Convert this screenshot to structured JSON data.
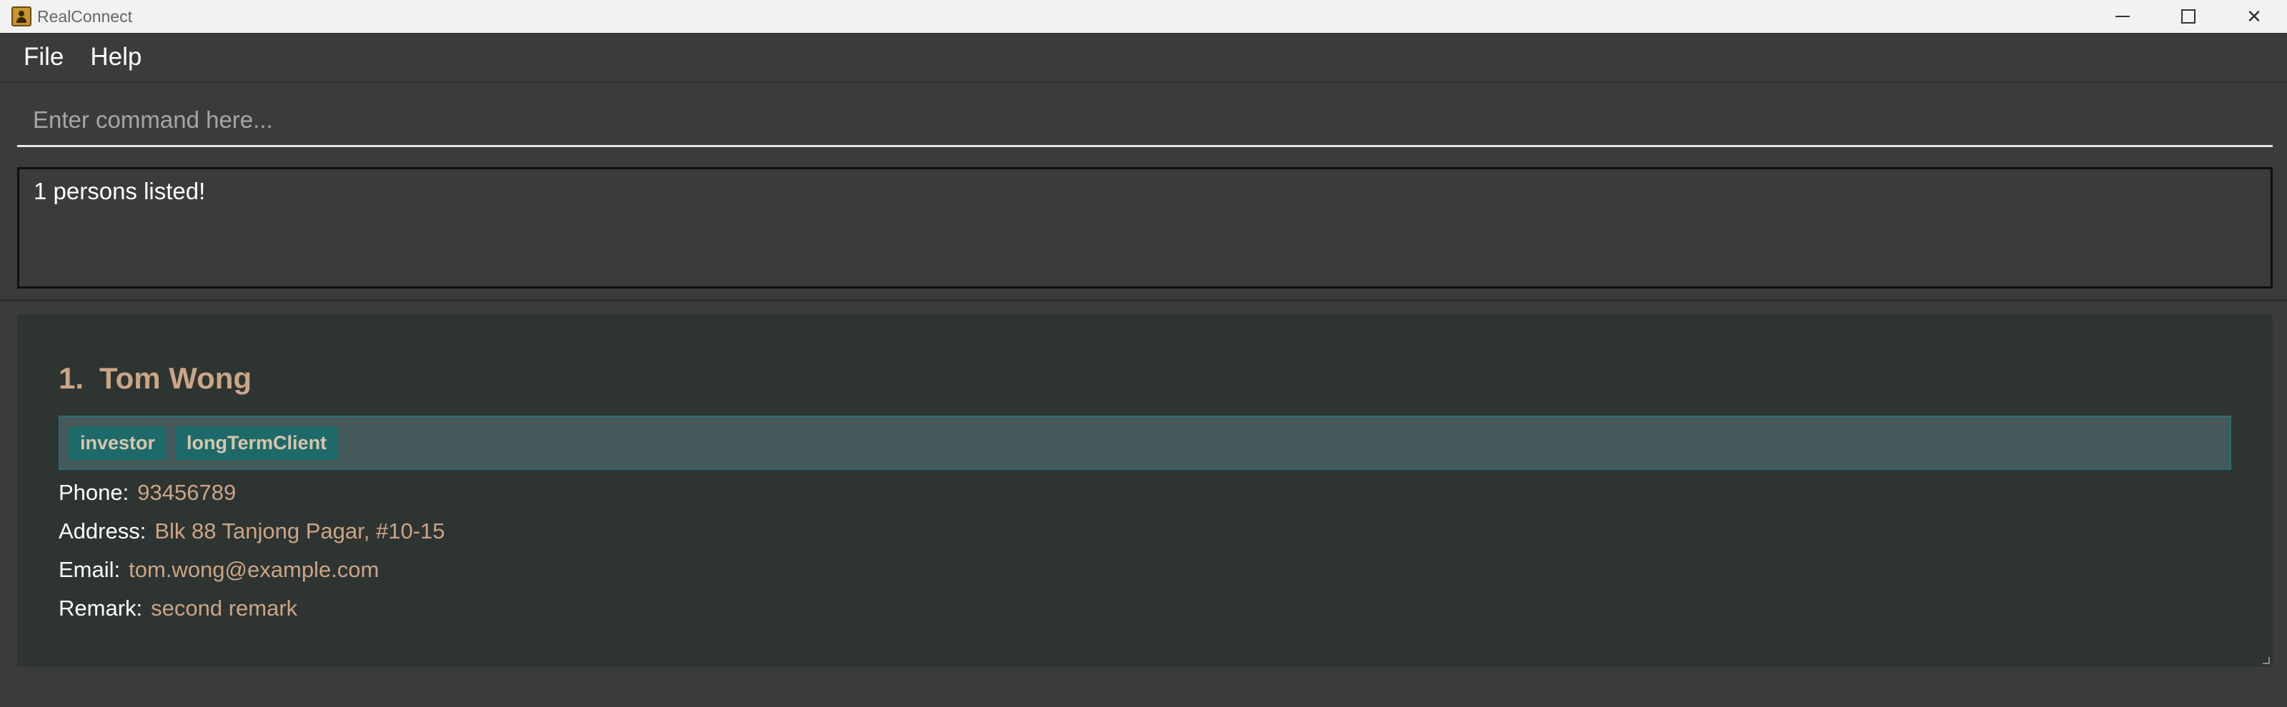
{
  "window": {
    "title": "RealConnect",
    "controls": {
      "minimize": "minimize-icon",
      "maximize": "maximize-icon",
      "close": "✕"
    }
  },
  "menu": {
    "items": [
      "File",
      "Help"
    ]
  },
  "command": {
    "placeholder": "Enter command here...",
    "value": ""
  },
  "result": {
    "message": "1 persons listed!"
  },
  "persons": [
    {
      "index": "1.",
      "name": "Tom Wong",
      "tags": [
        "investor",
        "longTermClient"
      ],
      "phone_label": "Phone:",
      "phone": "93456789",
      "address_label": "Address:",
      "address": "Blk 88 Tanjong Pagar, #10-15",
      "email_label": "Email:",
      "email": "tom.wong@example.com",
      "remark_label": "Remark:",
      "remark": "second remark"
    }
  ],
  "colors": {
    "background": "#3b3b3b",
    "card": "#2e3432",
    "accent": "#cba586",
    "tag": "#1e6a6a"
  }
}
